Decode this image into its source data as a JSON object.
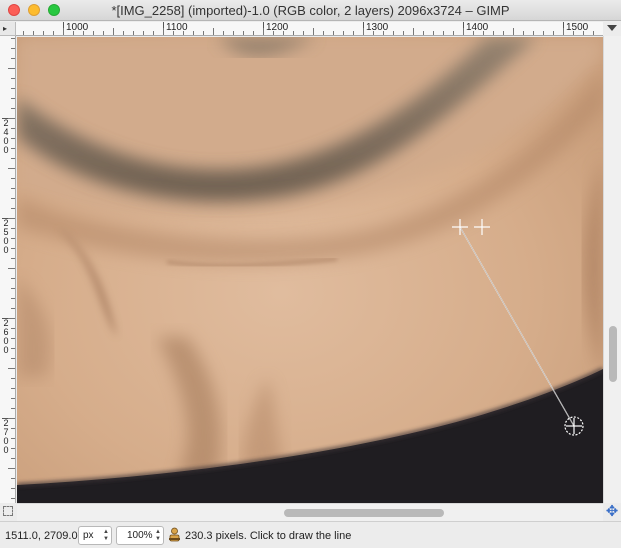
{
  "window": {
    "title": "*[IMG_2258] (imported)-1.0 (RGB color, 2 layers) 2096x3724 – GIMP"
  },
  "ruler": {
    "horizontal_labels": [
      "1000",
      "1100",
      "1200",
      "1300",
      "1400",
      "1500"
    ],
    "vertical_labels": [
      "2400",
      "2500",
      "2600",
      "2700"
    ]
  },
  "status": {
    "coordinates": "1511.0, 2709.0",
    "unit": "px",
    "zoom": "100%",
    "message": "230.3 pixels.  Click to draw the line"
  },
  "icons": {
    "corner": "ruler-corner-icon",
    "menu": "image-menu-arrow-icon",
    "quickmask": "quick-mask-toggle-icon",
    "navigate": "navigate-icon",
    "measure": "measure-tool-icon"
  },
  "colors": {
    "skin": "#d9b190",
    "shirt": "#1f1d21",
    "beard": "#6b5f52"
  }
}
